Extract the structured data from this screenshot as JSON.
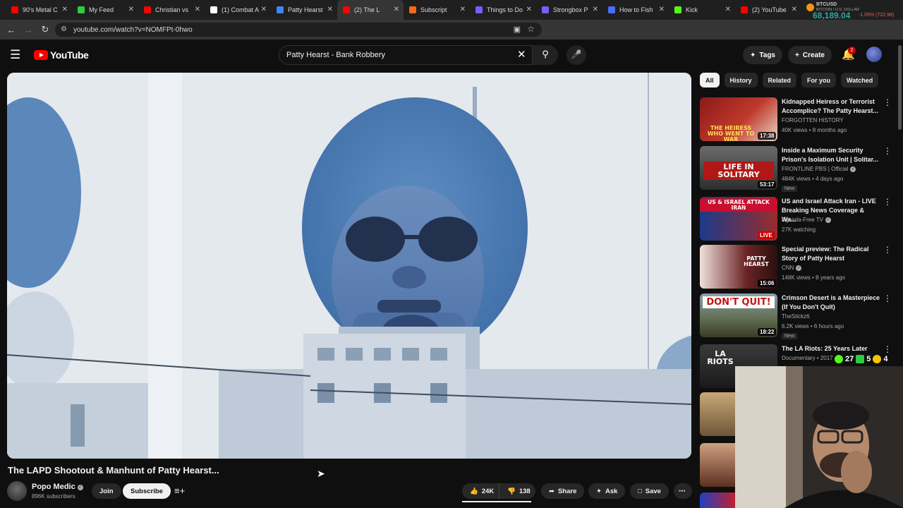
{
  "browser": {
    "tabs": [
      {
        "label": "90's Metal C",
        "color": "#ff0000"
      },
      {
        "label": "My Feed",
        "color": "#2ecc40"
      },
      {
        "label": "Christian vs",
        "color": "#ff0000"
      },
      {
        "label": "(1) Combat A",
        "color": "#ffffff"
      },
      {
        "label": "Patty Hearst",
        "color": "#4285f4"
      },
      {
        "label": "(2) The L",
        "color": "#ff0000"
      },
      {
        "label": "Subscript",
        "color": "#ff6719"
      },
      {
        "label": "Things to Do",
        "color": "#7b5cff"
      },
      {
        "label": "Strongbox P",
        "color": "#7b5cff"
      },
      {
        "label": "How to Fish",
        "color": "#4a6bff"
      },
      {
        "label": "Kick",
        "color": "#53fc18"
      },
      {
        "label": "(2) YouTube",
        "color": "#ff0000"
      }
    ],
    "url": "youtube.com/watch?v=NOMFPt-0hwo",
    "ticker": {
      "symbol": "BTCUSD",
      "subtitle": "BITCOIN / U.S. DOLLAR",
      "price": "68,189.04",
      "change": "-1.05% (722.98)"
    }
  },
  "youtube": {
    "logo_text": "YouTube",
    "search_value": "Patty Hearst - Bank Robbery",
    "tags_label": "Tags",
    "create_label": "Create",
    "notification_count": "2",
    "video": {
      "title": "The LAPD Shootout & Manhunt of Patty Hearst...",
      "channel": "Popo Medic",
      "subscribers": "896K subscribers",
      "join_label": "Join",
      "subscribe_label": "Subscribe",
      "likes": "24K",
      "dislikes": "138",
      "share_label": "Share",
      "ask_label": "Ask",
      "save_label": "Save"
    },
    "chips": [
      "All",
      "History",
      "Related",
      "For you",
      "Watched"
    ],
    "recommendations": [
      {
        "title": "Kidnapped Heiress or Terrorist Accomplice? The Patty Hearst...",
        "channel": "FORGOTTEN HISTORY",
        "meta": "40K views • 8 months ago",
        "duration": "17:38",
        "thumb_text": "THE HEIRESS WHO WENT TO WAR"
      },
      {
        "title": "Inside a Maximum Security Prison's Isolation Unit | Solitar...",
        "channel": "FRONTLINE PBS | Official",
        "meta": "484K views • 4 days ago",
        "duration": "53:17",
        "badge": "New",
        "thumb_text": "LIFE IN SOLITARY"
      },
      {
        "title": "US and Israel Attack Iran - LIVE Breaking News Coverage & Wa...",
        "channel": "Agenda-Free TV",
        "meta": "27K watching",
        "duration": "LIVE",
        "thumb_text": "US & ISRAEL ATTACK IRAN"
      },
      {
        "title": "Special preview: The Radical Story of Patty Hearst",
        "channel": "CNN",
        "meta": "148K views • 8 years ago",
        "duration": "15:06",
        "thumb_text": "PATTY HEARST"
      },
      {
        "title": "Crimson Desert is a Masterpiece (If You Don't Quit)",
        "channel": "TheStickz6",
        "meta": "6.2K views • 6 hours ago",
        "duration": "18:22",
        "badge": "New",
        "thumb_text": "DON'T QUIT!"
      },
      {
        "title": "The LA Riots: 25 Years Later",
        "channel": "Documentary • 2017",
        "thumb_text": "LA RIOTS"
      }
    ],
    "overlay": {
      "count_a": "27",
      "count_b": "5",
      "count_c": "4"
    }
  }
}
